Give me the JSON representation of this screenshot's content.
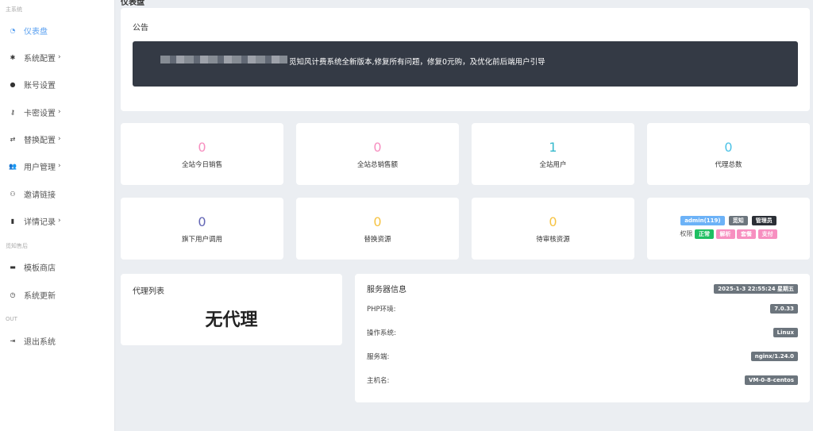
{
  "page_title": "仪表盘",
  "sidebar": {
    "sections": [
      "主系统",
      "觅知售后",
      "OUT"
    ],
    "items": [
      {
        "label": "仪表盘",
        "icon": "dashboard-icon",
        "glyph": "◔",
        "chev": ""
      },
      {
        "label": "系统配置",
        "icon": "gear-icon",
        "glyph": "✱",
        "chev": "›"
      },
      {
        "label": "账号设置",
        "icon": "user-icon",
        "glyph": "●",
        "chev": ""
      },
      {
        "label": "卡密设置",
        "icon": "key-icon",
        "glyph": "⚷",
        "chev": "›"
      },
      {
        "label": "替换配置",
        "icon": "exchange-icon",
        "glyph": "⇄",
        "chev": "›"
      },
      {
        "label": "用户管理",
        "icon": "users-icon",
        "glyph": "👥",
        "chev": "›"
      },
      {
        "label": "邀请链接",
        "icon": "user-plus-icon",
        "glyph": "⚇",
        "chev": ""
      },
      {
        "label": "详情记录",
        "icon": "clipboard-icon",
        "glyph": "▮",
        "chev": "›"
      },
      {
        "label": "模板商店",
        "icon": "store-icon",
        "glyph": "▬",
        "chev": ""
      },
      {
        "label": "系统更新",
        "icon": "history-icon",
        "glyph": "◷",
        "chev": ""
      },
      {
        "label": "退出系统",
        "icon": "sign-out-icon",
        "glyph": "⇥",
        "chev": ""
      }
    ]
  },
  "notice": {
    "title": "公告",
    "text": "觅知风计费系统全新版本,修复所有问题，修复0元购，及优化前后端用户引导"
  },
  "stats": [
    {
      "value": "0",
      "label": "全站今日销售",
      "color": "#f78fc0"
    },
    {
      "value": "0",
      "label": "全站总销售额",
      "color": "#f78fc0"
    },
    {
      "value": "1",
      "label": "全站用户",
      "color": "#36b9cc"
    },
    {
      "value": "0",
      "label": "代理总数",
      "color": "#4cc2e6"
    },
    {
      "value": "0",
      "label": "旗下用户调用",
      "color": "#6366b5"
    },
    {
      "value": "0",
      "label": "替换资源",
      "color": "#f6c343"
    },
    {
      "value": "0",
      "label": "待审核资源",
      "color": "#f6c343"
    }
  ],
  "user": {
    "name": "admin(119)",
    "level": "觅知",
    "role": "管理员",
    "perm_label": "权限",
    "perms": [
      "正常",
      "解析",
      "套餐",
      "支付"
    ]
  },
  "agents": {
    "title": "代理列表",
    "empty": "无代理"
  },
  "server": {
    "title": "服务器信息",
    "time": "2025-1-3 22:55:24 星期五",
    "rows": [
      {
        "label": "PHP环境:",
        "value": "7.0.33"
      },
      {
        "label": "操作系统:",
        "value": "Linux"
      },
      {
        "label": "服务端:",
        "value": "nginx/1.24.0"
      },
      {
        "label": "主机名:",
        "value": "VM-0-8-centos"
      }
    ]
  }
}
